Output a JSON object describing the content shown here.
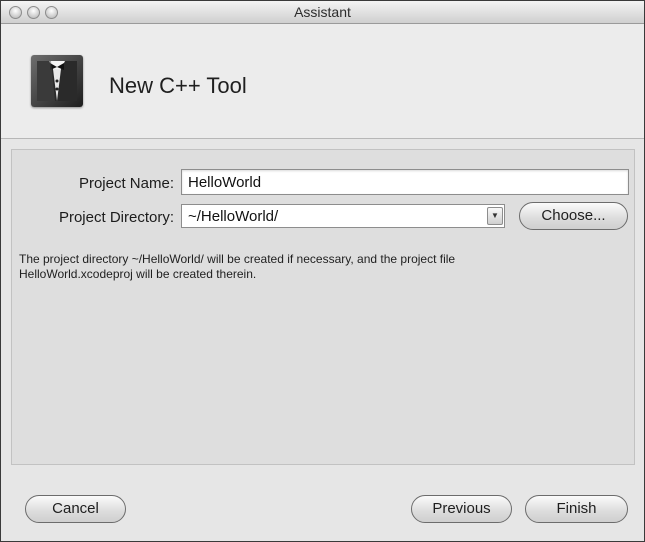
{
  "window": {
    "title": "Assistant"
  },
  "header": {
    "title": "New C++ Tool",
    "logo_icon": "tuxedo-icon"
  },
  "form": {
    "project_name_label": "Project Name:",
    "project_name_value": "HelloWorld",
    "project_directory_label": "Project Directory:",
    "project_directory_value": "~/HelloWorld/",
    "choose_label": "Choose...",
    "info_line1": "The project directory ~/HelloWorld/ will be created if necessary, and the project file",
    "info_line2": "HelloWorld.xcodeproj will be created therein."
  },
  "footer": {
    "cancel_label": "Cancel",
    "previous_label": "Previous",
    "finish_label": "Finish"
  }
}
